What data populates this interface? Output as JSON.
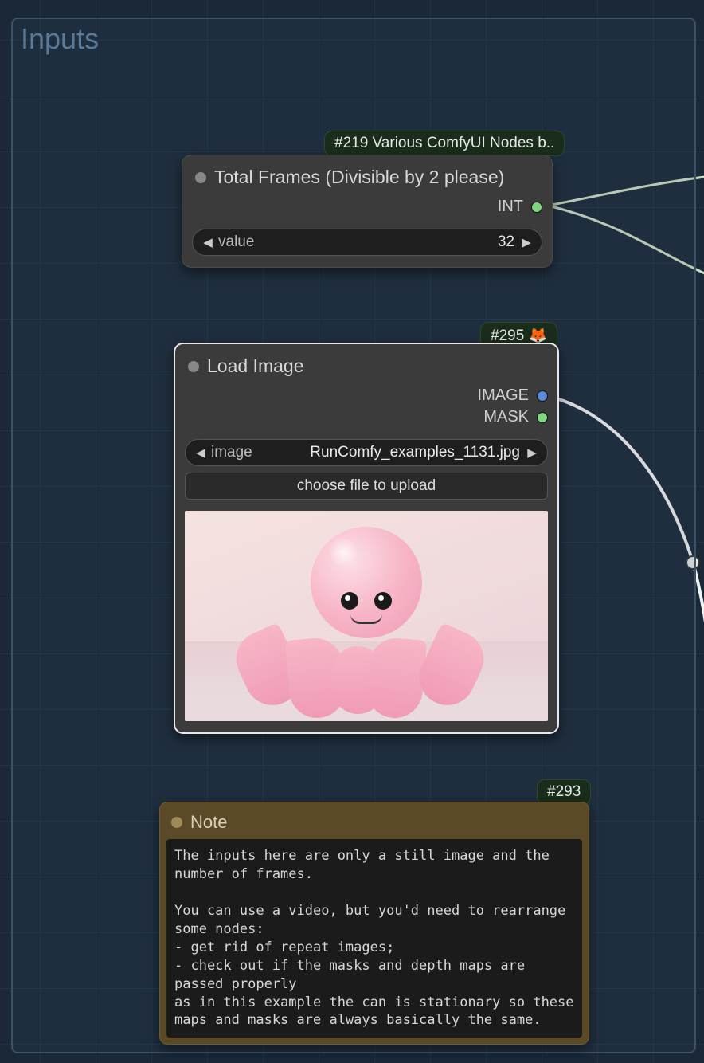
{
  "group": {
    "title": "Inputs"
  },
  "badges": {
    "total_frames_tag": "#219 Various ComfyUI Nodes b..",
    "load_image_tag": "#295 🦊",
    "note_tag": "#293"
  },
  "nodes": {
    "total_frames": {
      "title": "Total Frames (Divisible by 2 please)",
      "outputs": [
        {
          "label": "INT",
          "type": "int"
        }
      ],
      "widget": {
        "label": "value",
        "value": "32"
      }
    },
    "load_image": {
      "title": "Load Image",
      "outputs": [
        {
          "label": "IMAGE",
          "type": "image"
        },
        {
          "label": "MASK",
          "type": "mask"
        }
      ],
      "image_widget": {
        "label": "image",
        "value": "RunComfy_examples_1131.jpg"
      },
      "upload_button": "choose file to upload"
    },
    "note": {
      "title": "Note",
      "text": "The inputs here are only a still image and the number of frames.\n\nYou can use a video, but you'd need to rearrange some nodes:\n- get rid of repeat images;\n- check out if the masks and depth maps are passed properly\nas in this example the can is stationary so these maps and masks are always basically the same."
    }
  },
  "colors": {
    "port_int": "#7fd87f",
    "port_image": "#5a8ad8",
    "port_mask": "#7fd87f"
  }
}
